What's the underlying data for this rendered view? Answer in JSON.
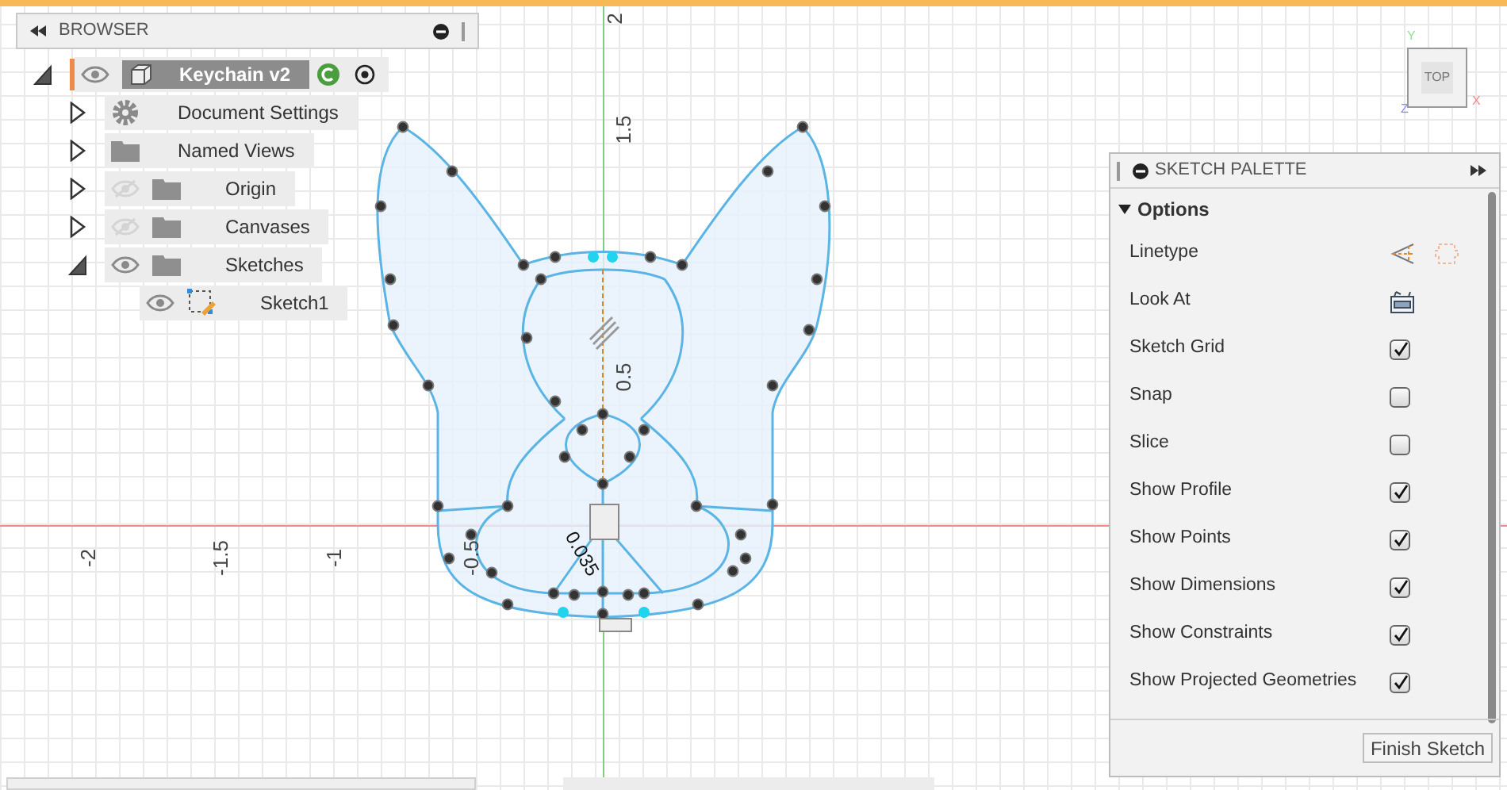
{
  "browser": {
    "title": "BROWSER",
    "root": {
      "label": "Keychain v2",
      "expanded": true,
      "visible": true,
      "children": [
        {
          "label": "Document Settings",
          "kind": "settings",
          "expanded": false
        },
        {
          "label": "Named Views",
          "kind": "folder",
          "expanded": false
        },
        {
          "label": "Origin",
          "kind": "folder",
          "expanded": false,
          "visible": false
        },
        {
          "label": "Canvases",
          "kind": "folder",
          "expanded": false,
          "visible": false
        },
        {
          "label": "Sketches",
          "kind": "folder",
          "expanded": true,
          "visible": true,
          "children": [
            {
              "label": "Sketch1",
              "kind": "sketch",
              "visible": true
            }
          ]
        }
      ]
    }
  },
  "axis_labels": {
    "vertical": [
      "2",
      "1.5",
      "0.5"
    ],
    "horizontal": [
      "-2",
      "-1.5",
      "-1",
      "-0.5"
    ],
    "dimension": "0.035"
  },
  "viewcube": {
    "face": "TOP",
    "axes": [
      "Y",
      "X",
      "Z"
    ]
  },
  "palette": {
    "title": "SKETCH PALETTE",
    "section": {
      "label": "Options",
      "expanded": true
    },
    "rows": [
      {
        "label": "Linetype",
        "kind": "linetype"
      },
      {
        "label": "Look At",
        "kind": "look_at"
      },
      {
        "label": "Sketch Grid",
        "kind": "checkbox",
        "checked": true
      },
      {
        "label": "Snap",
        "kind": "checkbox",
        "checked": false
      },
      {
        "label": "Slice",
        "kind": "checkbox",
        "checked": false
      },
      {
        "label": "Show Profile",
        "kind": "checkbox",
        "checked": true
      },
      {
        "label": "Show Points",
        "kind": "checkbox",
        "checked": true
      },
      {
        "label": "Show Dimensions",
        "kind": "checkbox",
        "checked": true
      },
      {
        "label": "Show Constraints",
        "kind": "checkbox",
        "checked": true
      },
      {
        "label": "Show Projected Geometries",
        "kind": "checkbox",
        "checked": true
      }
    ],
    "button": "Finish Sketch"
  }
}
